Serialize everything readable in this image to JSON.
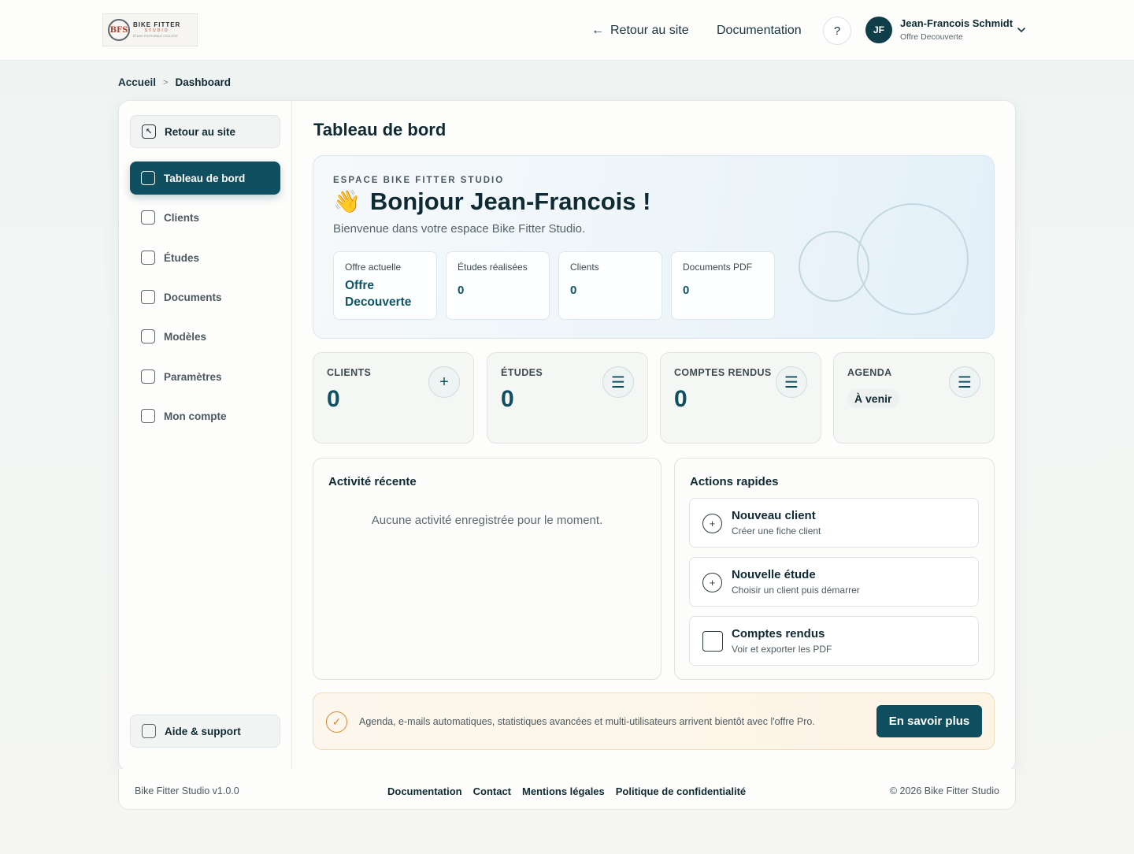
{
  "header": {
    "logo": {
      "mark": "BFS",
      "title": "BIKE FITTER",
      "subtitle": "STUDIO",
      "tagline": "ÉTUDE POSTURALE CYCLISTE"
    },
    "back_link": "Retour au site",
    "back_arrow": "←",
    "documentation": "Documentation",
    "help": "?",
    "user": {
      "initials": "JF",
      "name": "Jean-Francois Schmidt",
      "plan": "Offre Decouverte"
    }
  },
  "breadcrumb": {
    "home": "Accueil",
    "separator": ">",
    "current": "Dashboard"
  },
  "sidebar": {
    "back": "Retour au site",
    "items": [
      {
        "label": "Tableau de bord",
        "active": true
      },
      {
        "label": "Clients"
      },
      {
        "label": "Études"
      },
      {
        "label": "Documents"
      },
      {
        "label": "Modèles"
      },
      {
        "label": "Paramètres"
      },
      {
        "label": "Mon compte"
      }
    ],
    "support": "Aide & support"
  },
  "main": {
    "title": "Tableau de bord",
    "hero": {
      "kicker": "ESPACE BIKE FITTER STUDIO",
      "emoji": "👋",
      "greeting": "Bonjour Jean-Francois !",
      "subtitle": "Bienvenue dans votre espace Bike Fitter Studio.",
      "stats": [
        {
          "label": "Offre actuelle",
          "value": "Offre Decouverte"
        },
        {
          "label": "Études réalisées",
          "value": "0"
        },
        {
          "label": "Clients",
          "value": "0"
        },
        {
          "label": "Documents PDF",
          "value": "0"
        }
      ]
    },
    "kpis": [
      {
        "label": "CLIENTS",
        "value": "0",
        "icon": "plus-icon",
        "glyph": "+"
      },
      {
        "label": "ÉTUDES",
        "value": "0",
        "icon": "list-icon",
        "glyph": "☰"
      },
      {
        "label": "COMPTES RENDUS",
        "value": "0",
        "icon": "list-icon",
        "glyph": "☰"
      },
      {
        "label": "AGENDA",
        "value": "À venir",
        "icon": "list-icon",
        "glyph": "☰"
      }
    ],
    "activity": {
      "title": "Activité récente",
      "empty": "Aucune activité enregistrée pour le moment."
    },
    "quick_actions": {
      "title": "Actions rapides",
      "items": [
        {
          "title": "Nouveau client",
          "subtitle": "Créer une fiche client",
          "glyph": "+"
        },
        {
          "title": "Nouvelle étude",
          "subtitle": "Choisir un client puis démarrer",
          "glyph": "+"
        },
        {
          "title": "Comptes rendus",
          "subtitle": "Voir et exporter les PDF",
          "glyph": ""
        }
      ]
    },
    "promo": {
      "check": "✓",
      "text": "Agenda, e-mails automatiques, statistiques avancées et multi-utilisateurs arrivent bientôt avec l'offre Pro.",
      "button": "En savoir plus"
    }
  },
  "footer": {
    "version": "Bike Fitter Studio v1.0.0",
    "links": [
      "Documentation",
      "Contact",
      "Mentions légales",
      "Politique de confidentialité"
    ],
    "copyright": "© 2026 Bike Fitter Studio"
  },
  "colors": {
    "primary": "#0f4f60",
    "accent_orange": "#d48a2a",
    "text_dark": "#0f2a33",
    "background": "#f3f6f4"
  }
}
